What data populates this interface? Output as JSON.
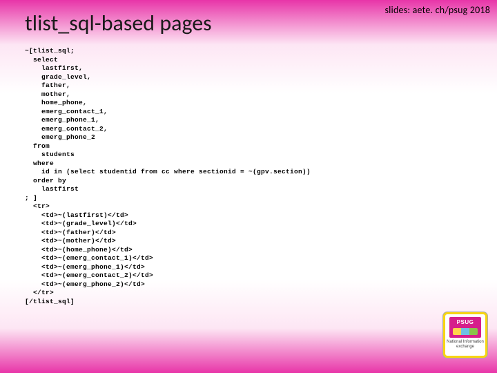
{
  "header": {
    "link": "slides: aete. ch/psug 2018"
  },
  "title": "tlist_sql-based pages",
  "code": "~[tlist_sql;\n  select\n    lastfirst,\n    grade_level,\n    father,\n    mother,\n    home_phone,\n    emerg_contact_1,\n    emerg_phone_1,\n    emerg_contact_2,\n    emerg_phone_2\n  from\n    students\n  where\n    id in (select studentid from cc where sectionid = ~(gpv.section))\n  order by\n    lastfirst\n; ]\n  <tr>\n    <td>~(lastfirst)</td>\n    <td>~(grade_level)</td>\n    <td>~(father)</td>\n    <td>~(mother)</td>\n    <td>~(home_phone)</td>\n    <td>~(emerg_contact_1)</td>\n    <td>~(emerg_phone_1)</td>\n    <td>~(emerg_contact_2)</td>\n    <td>~(emerg_phone_2)</td>\n  </tr>\n[/tlist_sql]",
  "logo": {
    "label": "National Information exchange"
  }
}
